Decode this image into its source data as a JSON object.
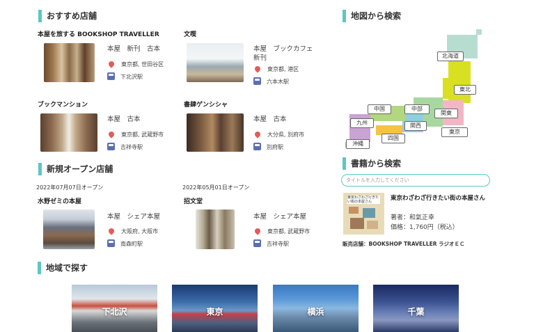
{
  "recommended": {
    "title": "おすすめ店舗",
    "stores": [
      {
        "name": "本屋を旅する BOOKSHOP TRAVELLER",
        "tags": "本屋　新刊　古本",
        "address": "東京都, 世田谷区",
        "station": "下北沢駅"
      },
      {
        "name": "文喫",
        "tags": "本屋　ブックカフェ　新刊",
        "address": "東京都, 港区",
        "station": "六本木駅"
      },
      {
        "name": "ブックマンション",
        "tags": "本屋　古本",
        "address": "東京都, 武蔵野市",
        "station": "吉祥寺駅"
      },
      {
        "name": "書肆ゲンシシャ",
        "tags": "本屋　古本",
        "address": "大分県, 別府市",
        "station": "別府駅"
      }
    ]
  },
  "new_open": {
    "title": "新規オープン店舗",
    "stores": [
      {
        "date": "2022年07月07日オープン",
        "name": "水野ゼミの本屋",
        "tags": "本屋　シェア本屋",
        "address": "大阪府, 大阪市",
        "station": "南森町駅"
      },
      {
        "date": "2022年05月01日オープン",
        "name": "招文堂",
        "tags": "本屋　シェア本屋",
        "address": "東京都, 武蔵野市",
        "station": "吉祥寺駅"
      }
    ]
  },
  "map_search": {
    "title": "地図から検索",
    "regions": [
      "北海道",
      "東北",
      "関東",
      "東京",
      "中部",
      "中国",
      "九州",
      "沖縄",
      "四国",
      "関西"
    ],
    "colors": {
      "hokkaido": "#b7ddd0",
      "tohoku": "#d9e021",
      "kanto": "#f2b6c6",
      "chubu": "#a8d8a0",
      "kansai": "#8ed0e0",
      "chugoku": "#b3d77e",
      "shikoku": "#f5c242",
      "kyushu": "#c9a3d4",
      "okinawa": "#c9a3d4"
    }
  },
  "book_search": {
    "title": "書籍から検索",
    "placeholder": "タイトルを入力してください",
    "book_title": "東京わざわざ行きたい街の本屋さん",
    "author": "著者：和氣正幸",
    "price": "価格：1,760円（税込）",
    "seller": "販売店舗：BOOKSHOP TRAVELLER  ラジオＥＣ",
    "cover_text": "東京わざわざ行きたい街の本屋さん"
  },
  "area_search": {
    "title": "地域で探す",
    "areas": [
      "下北沢",
      "東京",
      "横浜",
      "千葉"
    ]
  }
}
